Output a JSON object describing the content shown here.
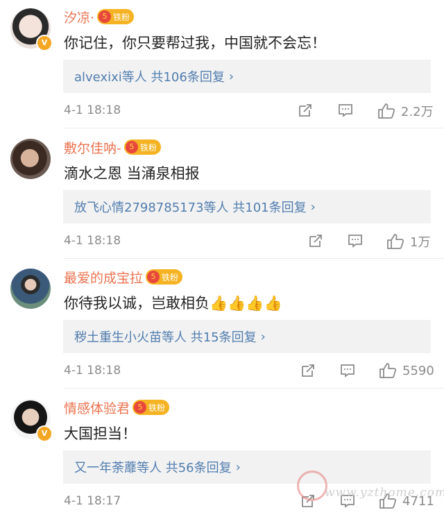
{
  "comments": [
    {
      "username": "汐凉·",
      "badge": "铁粉",
      "text": "你记住，你只要帮过我，中国就不会忘！",
      "replies": "alvexixi等人 共106条回复",
      "time": "4-1 18:18",
      "likes": "2.2万"
    },
    {
      "username": "敷尔佳呐-",
      "badge": "铁粉",
      "text": "滴水之恩 当涌泉相报",
      "replies": "放飞心情2798785173等人 共101条回复",
      "time": "4-1 18:18",
      "likes": "1万"
    },
    {
      "username": "最爱的成宝拉",
      "badge": "铁粉",
      "text": "你待我以诚，岂敢相负👍👍👍👍",
      "replies": "秽土重生小火苗等人 共15条回复",
      "time": "4-1 18:18",
      "likes": "5590"
    },
    {
      "username": "情感体验君",
      "badge": "铁粉",
      "text": "大国担当！",
      "replies": "又一年荼蘼等人 共56条回复",
      "time": "4-1 18:17",
      "likes": "4711"
    }
  ],
  "badge_level": "5",
  "verify_mark": "V",
  "chevron": "›",
  "watermark": {
    "text": "www.yzthome.com"
  },
  "colors": {
    "username": "#eb7350",
    "link": "#507daf",
    "meta": "#8a8a8a",
    "badge": "#f5b323",
    "reply_bg": "#f2f2f2"
  },
  "icons": [
    "verified-icon",
    "fan-badge-icon",
    "repost-icon",
    "comment-icon",
    "like-icon",
    "chevron-right-icon"
  ]
}
